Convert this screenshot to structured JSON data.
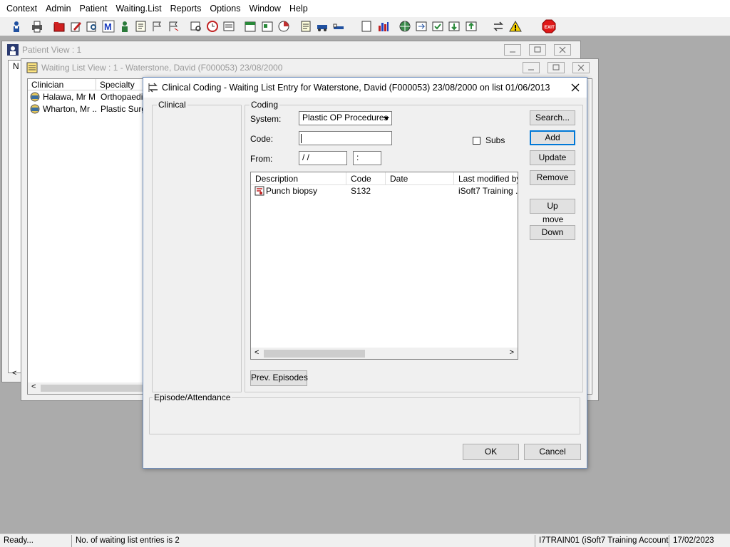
{
  "menu": [
    "Context",
    "Admin",
    "Patient",
    "Waiting.List",
    "Reports",
    "Options",
    "Window",
    "Help"
  ],
  "toolbar_icons": [
    "person-icon",
    "printer-icon",
    "folder-red-icon",
    "edit-red-icon",
    "document-search-icon",
    "m-icon",
    "nurse-icon",
    "note-icon",
    "flag-icon",
    "flag-send-icon",
    "search-doc-icon",
    "clock-icon",
    "window-icon",
    "calendar-icon",
    "file-icon",
    "chart-icon",
    "notes-icon",
    "car-icon",
    "bed-icon",
    "page-icon",
    "bar-chart-icon",
    "globe-icon",
    "transfer-icon",
    "check-list-icon",
    "arrow-down-icon",
    "arrow-up-icon",
    "swap-icon",
    "warning-icon",
    "exit-icon"
  ],
  "patient_view": {
    "title": "Patient View : 1",
    "col_partial": "N"
  },
  "waiting_view": {
    "title": "Waiting List View :  1 - Waterstone, David (F000053) 23/08/2000",
    "columns": [
      "Clinician",
      "Specialty"
    ],
    "rows": [
      {
        "clinician": "Halawa, Mr M",
        "specialty": "Orthopaedic"
      },
      {
        "clinician": "Wharton, Mr ...",
        "specialty": "Plastic Surge"
      }
    ]
  },
  "dialog": {
    "title": "Clinical Coding - Waiting List Entry for Waterstone, David (F000053) 23/08/2000 on list 01/06/2013",
    "clinical_label": "Clinical",
    "coding_label": "Coding",
    "system_label": "System:",
    "system_value": "Plastic OP Procedures",
    "code_label": "Code:",
    "code_value": "",
    "from_label": "From:",
    "from_date": " /  /",
    "from_time": " :",
    "subs_label": "Subs",
    "subs_checked": false,
    "table_columns": [
      "Description",
      "Code",
      "Date",
      "Last modified by"
    ],
    "table_rows": [
      {
        "description": "Punch biopsy",
        "code": "S132",
        "date": "",
        "modified_by": "iSoft7 Training ..."
      }
    ],
    "buttons": {
      "search": "Search...",
      "add": "Add",
      "update": "Update",
      "remove": "Remove",
      "up": "Up",
      "move": "move",
      "down": "Down",
      "prev_episodes": "Prev. Episodes",
      "ok": "OK",
      "cancel": "Cancel"
    },
    "episode_label": "Episode/Attendance"
  },
  "status": {
    "ready": "Ready...",
    "entries": "No. of waiting list entries is 2",
    "account": "I7TRAIN01 (iSoft7 Training Account)",
    "date": "17/02/2023"
  },
  "colors": {
    "desktop": "#ababab",
    "exit": "#e01818",
    "selection_header": "#0078d7"
  }
}
